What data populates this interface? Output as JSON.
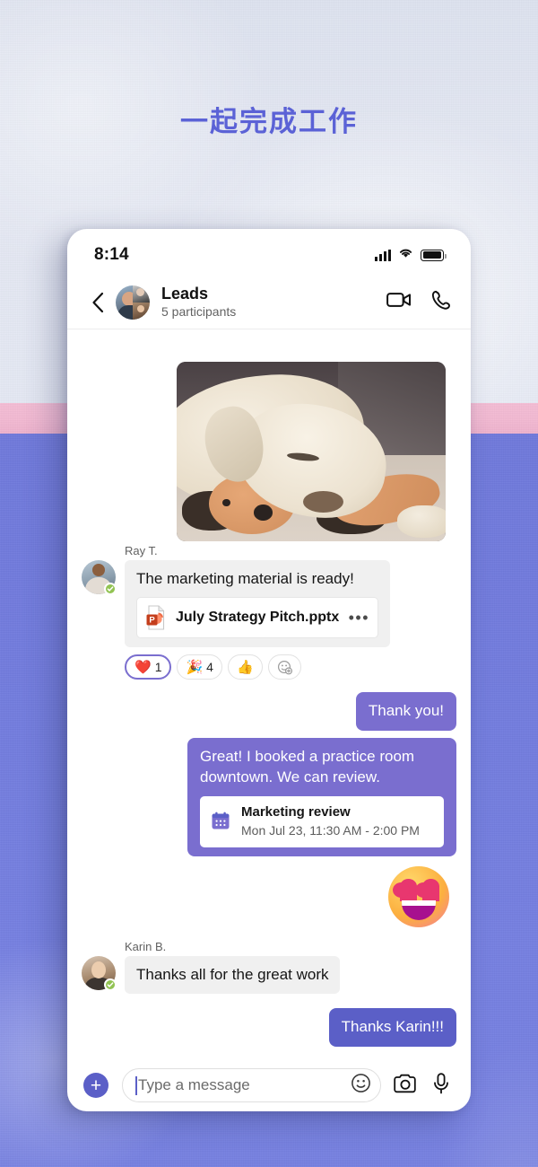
{
  "headline": "一起完成工作",
  "colors": {
    "accent_purple": "#5b5fc7",
    "bubble_out": "#7a6ecf",
    "bubble_out_dark": "#5b5fc7",
    "bubble_in": "#f0f0f0",
    "presence_green": "#92c353",
    "band_pink": "#f2b9d2",
    "band_blue": "#757fe0",
    "wall_gray": "#e3e7f2"
  },
  "phone": {
    "status_bar": {
      "time": "8:14",
      "signal_icon": "cellular-signal-icon",
      "wifi_icon": "wifi-icon",
      "battery_icon": "battery-full-icon"
    },
    "header": {
      "back_icon": "chevron-left-icon",
      "avatar": "group-avatar",
      "title": "Leads",
      "subtitle": "5 participants",
      "video_icon": "video-call-icon",
      "call_icon": "audio-call-icon"
    },
    "messages": [
      {
        "kind": "photo",
        "alt": "sleeping dog with plush toy"
      },
      {
        "kind": "incoming",
        "sender": "Ray T.",
        "text": "The marketing material is ready!",
        "attachment": {
          "icon": "powerpoint-file-icon",
          "name": "July Strategy Pitch.pptx",
          "overflow": "•••"
        },
        "reactions": [
          {
            "emoji": "❤️",
            "name": "heart-reaction",
            "count": "1",
            "active": true
          },
          {
            "emoji": "🎉",
            "name": "celebrate-reaction",
            "count": "4",
            "active": false
          },
          {
            "emoji": "👍",
            "name": "thumbsup-reaction",
            "count": "",
            "active": false
          },
          {
            "emoji": "",
            "name": "add-reaction",
            "count": "",
            "active": false
          }
        ]
      },
      {
        "kind": "outgoing",
        "text": "Thank you!"
      },
      {
        "kind": "outgoing",
        "text": "Great! I booked a practice room downtown. We can review.",
        "event": {
          "icon": "calendar-icon",
          "title": "Marketing review",
          "time": "Mon Jul 23, 11:30 AM - 2:00 PM"
        }
      },
      {
        "kind": "emoji",
        "emoji": "😍",
        "name": "heart-eyes-emoji-message"
      },
      {
        "kind": "incoming",
        "sender": "Karin B.",
        "text": "Thanks all for the great work"
      },
      {
        "kind": "outgoing",
        "text": "Thanks Karin!!!"
      }
    ],
    "compose": {
      "add_label": "+",
      "placeholder": "Type a message",
      "emoji_icon": "emoji-smiley-icon",
      "camera_icon": "camera-icon",
      "mic_icon": "microphone-icon"
    }
  }
}
